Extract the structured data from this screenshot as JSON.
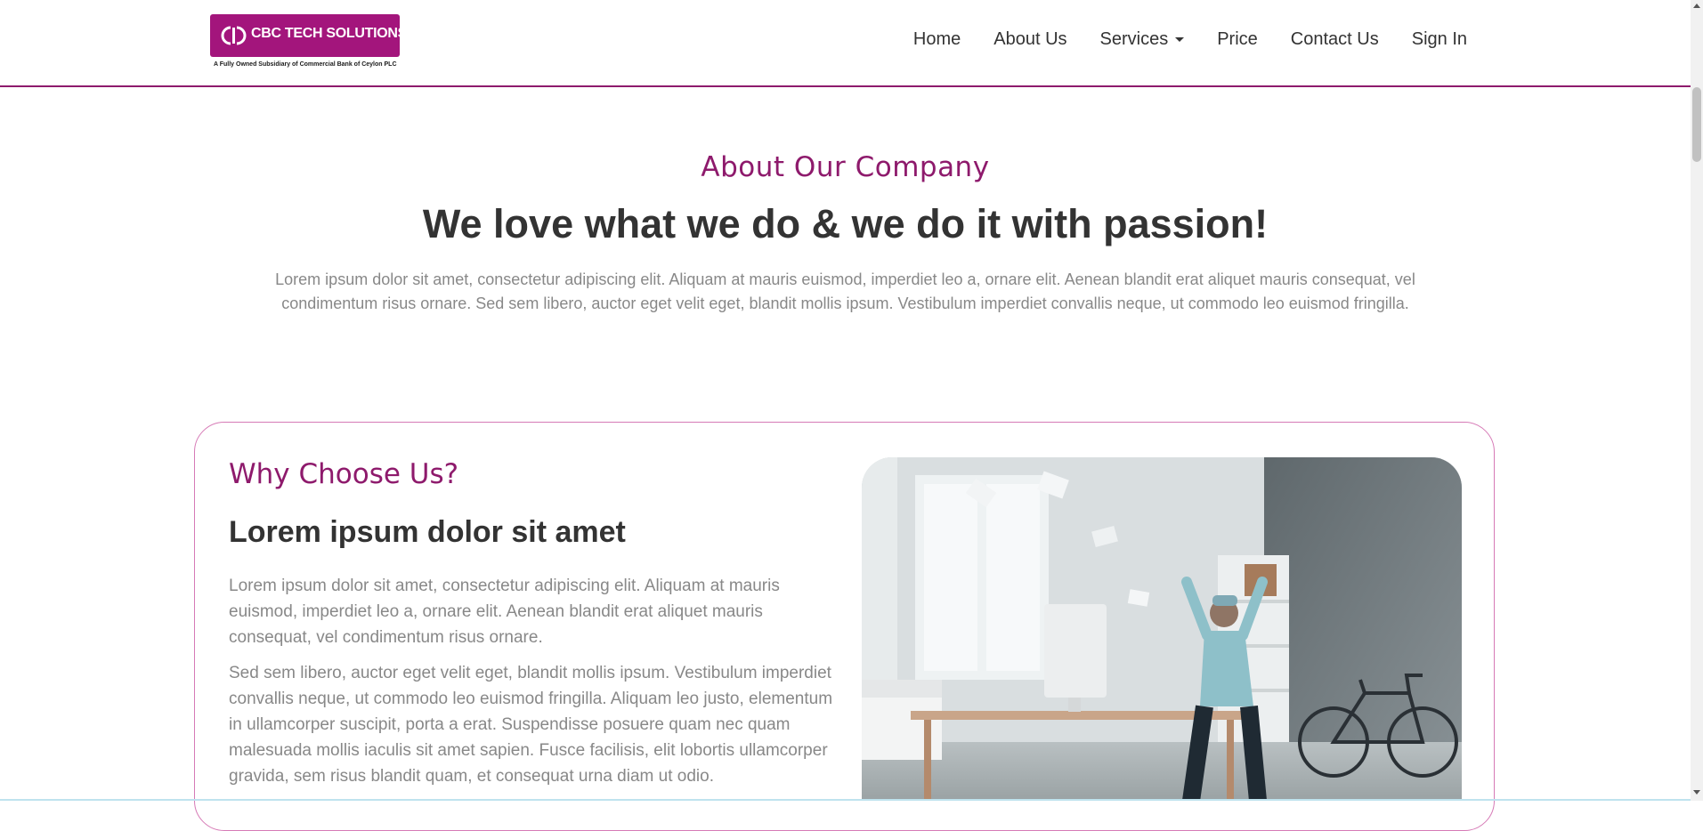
{
  "brand": {
    "name": "CBC TECH SOLUTIONS",
    "tagline": "A Fully Owned Subsidiary of Commercial Bank of Ceylon PLC",
    "accent_color": "#8e1a6c",
    "logo_color": "#a3157c"
  },
  "nav": {
    "items": [
      {
        "label": "Home"
      },
      {
        "label": "About Us"
      },
      {
        "label": "Services"
      },
      {
        "label": "Price"
      },
      {
        "label": "Contact Us"
      },
      {
        "label": "Sign In"
      }
    ]
  },
  "about": {
    "eyebrow": "About Our Company",
    "title": "We love what we do & we do it with passion!",
    "text": "Lorem ipsum dolor sit amet, consectetur adipiscing elit. Aliquam at mauris euismod, imperdiet leo a, ornare elit. Aenean blandit erat aliquet mauris consequat, vel condimentum risus ornare. Sed sem libero, auctor eget velit eget, blandit mollis ipsum. Vestibulum imperdiet convallis neque, ut commodo leo euismod fringilla."
  },
  "why": {
    "eyebrow": "Why Choose Us?",
    "title": "Lorem ipsum dolor sit amet",
    "paragraph1": "Lorem ipsum dolor sit amet, consectetur adipiscing elit. Aliquam at mauris euismod, imperdiet leo a, ornare elit. Aenean blandit erat aliquet mauris consequat, vel condimentum risus ornare.",
    "paragraph2": "Sed sem libero, auctor eget velit eget, blandit mollis ipsum. Vestibulum imperdiet convallis neque, ut commodo leo euismod fringilla. Aliquam leo justo, elementum in ullamcorper suscipit, porta a erat. Suspendisse posuere quam nec quam malesuada mollis iaculis sit amet sapien. Fusce facilisis, elit lobortis ullamcorper gravida, sem risus blandit quam, et consequat urna diam ut odio."
  },
  "icons": {
    "services_dropdown": "caret-down-icon",
    "logo": "cbc-logo-icon"
  }
}
